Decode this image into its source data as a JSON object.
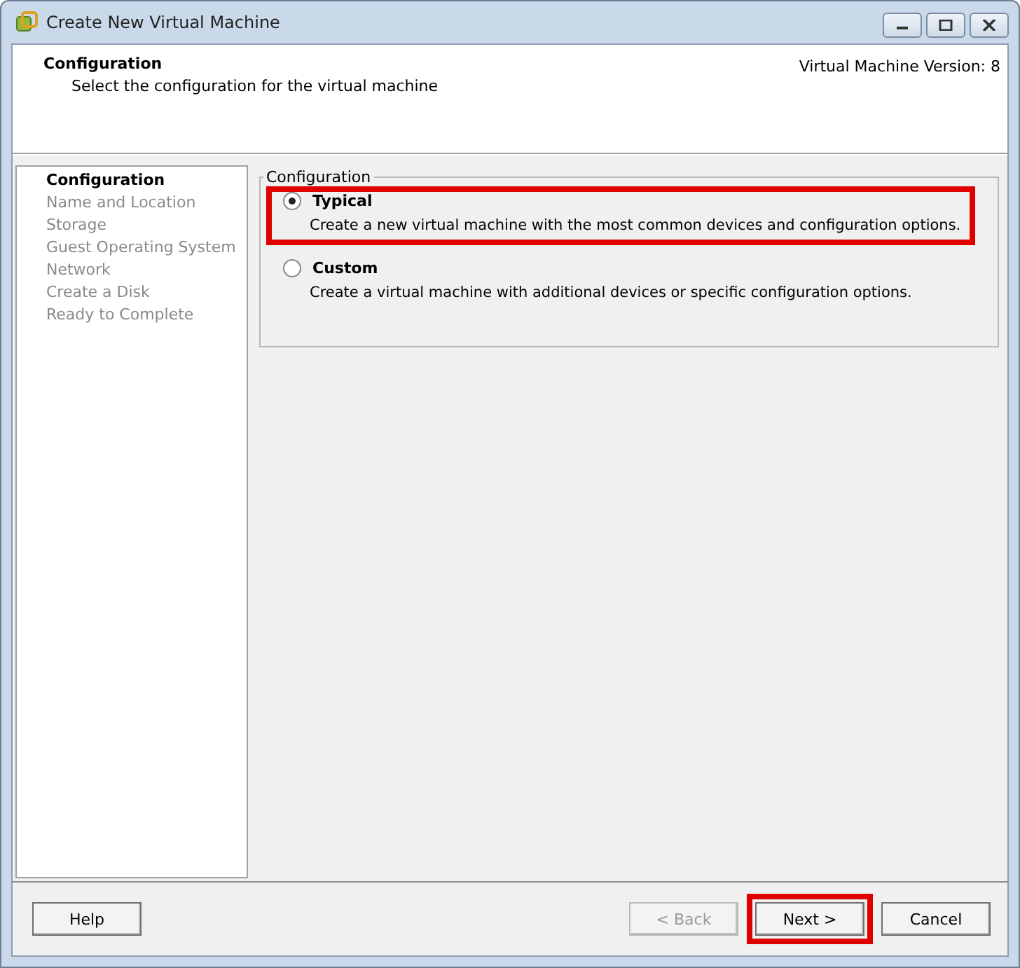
{
  "window": {
    "title": "Create New Virtual Machine"
  },
  "header": {
    "title": "Configuration",
    "subtitle": "Select the configuration for the virtual machine",
    "version": "Virtual Machine Version: 8"
  },
  "steps": [
    {
      "label": "Configuration",
      "selected": true
    },
    {
      "label": "Name and Location",
      "selected": false
    },
    {
      "label": "Storage",
      "selected": false
    },
    {
      "label": "Guest Operating System",
      "selected": false
    },
    {
      "label": "Network",
      "selected": false
    },
    {
      "label": "Create a Disk",
      "selected": false
    },
    {
      "label": "Ready to Complete",
      "selected": false
    }
  ],
  "group": {
    "legend": "Configuration",
    "options": [
      {
        "label": "Typical",
        "description": "Create a new virtual machine with the most common devices and configuration options.",
        "selected": true,
        "highlighted": true
      },
      {
        "label": "Custom",
        "description": "Create a virtual machine with additional devices or specific configuration options.",
        "selected": false,
        "highlighted": false
      }
    ]
  },
  "buttons": [
    {
      "label": "Help",
      "kind": "left",
      "disabled": false,
      "highlighted": false
    },
    {
      "label": "< Back",
      "kind": "right",
      "disabled": true,
      "highlighted": false
    },
    {
      "label": "Next >",
      "kind": "right",
      "disabled": false,
      "highlighted": true
    },
    {
      "label": "Cancel",
      "kind": "right",
      "disabled": false,
      "highlighted": false
    }
  ]
}
